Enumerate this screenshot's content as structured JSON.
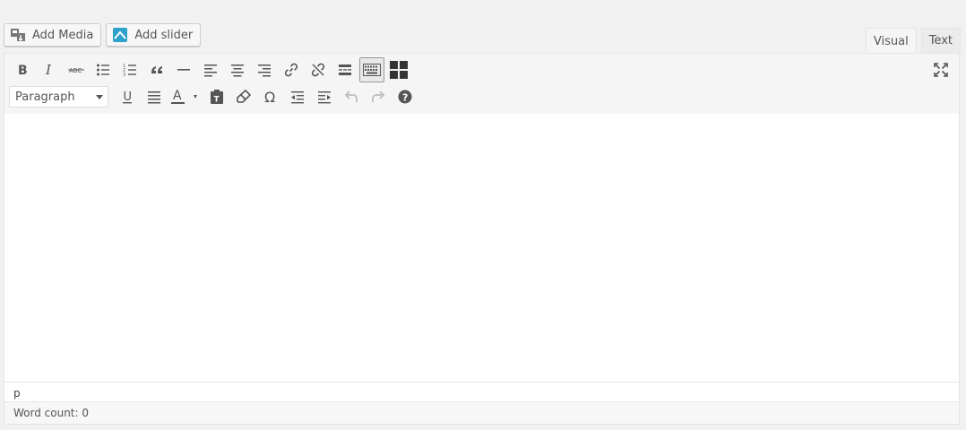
{
  "media_buttons": {
    "add_media": "Add Media",
    "add_slider": "Add slider"
  },
  "tabs": {
    "visual": "Visual",
    "text": "Text",
    "active": "visual"
  },
  "toolbar": {
    "format_select": "Paragraph",
    "row1_icons": [
      "bold-icon",
      "italic-icon",
      "strikethrough-icon",
      "bulleted-list-icon",
      "numbered-list-icon",
      "blockquote-icon",
      "horizontal-rule-icon",
      "align-left-icon",
      "align-center-icon",
      "align-right-icon",
      "insert-link-icon",
      "remove-link-icon",
      "read-more-icon",
      "toolbar-toggle-icon",
      "slider-grid-icon"
    ],
    "row2_icons": [
      "underline-icon",
      "justify-icon",
      "text-color-icon",
      "paste-as-text-icon",
      "clear-formatting-icon",
      "special-character-icon",
      "outdent-icon",
      "indent-icon",
      "undo-icon",
      "redo-icon",
      "help-icon"
    ]
  },
  "path_bar": "p",
  "status": {
    "word_count": "Word count: 0"
  },
  "colors": {
    "background": "#f1f1f1",
    "toolbar_bg": "#f5f5f5",
    "icon": "#555555",
    "slider_icon": "#2ea2cc"
  }
}
